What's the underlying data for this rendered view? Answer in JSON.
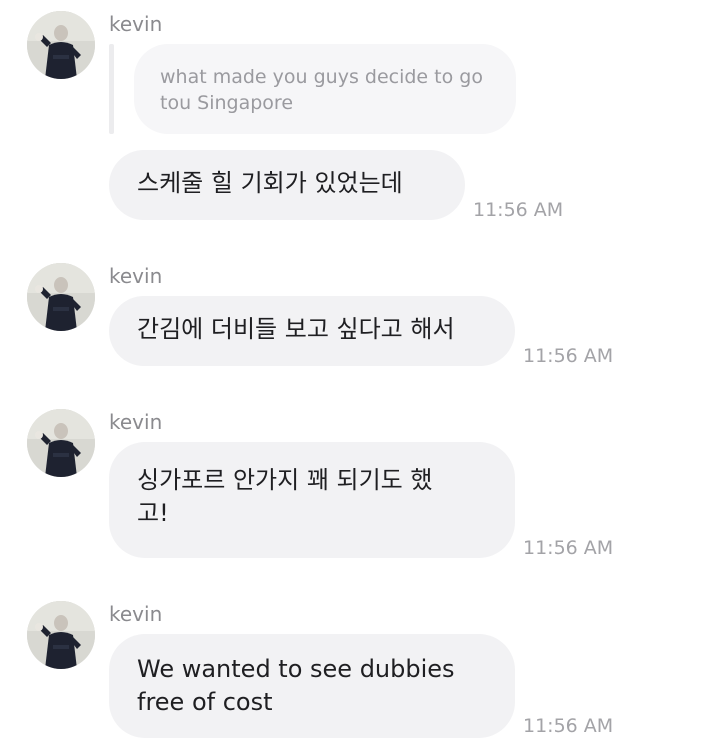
{
  "messages": [
    {
      "sender": "kevin",
      "reply": "what made you guys decide to go tou Singapore",
      "text": "스케줄 힐 기회가 있었는데",
      "time": "11:56 AM"
    },
    {
      "sender": "kevin",
      "text": "간김에 더비들 보고 싶다고 해서",
      "time": "11:56 AM"
    },
    {
      "sender": "kevin",
      "text_line1": "싱가포르 안가지 꽤 되기도 했",
      "text_line2": "고!",
      "time": "11:56 AM"
    },
    {
      "sender": "kevin",
      "text_line1": "We wanted to see dubbies",
      "text_line2": "free of cost",
      "time": "11:56 AM"
    }
  ],
  "avatar_icon": "user-photo-avatar",
  "colors": {
    "bubble": "#f2f2f4",
    "reply_bubble": "#f6f6f8",
    "sender_text": "#8a8a8e",
    "time_text": "#a3a3a7",
    "message_text": "#1f1f22"
  }
}
